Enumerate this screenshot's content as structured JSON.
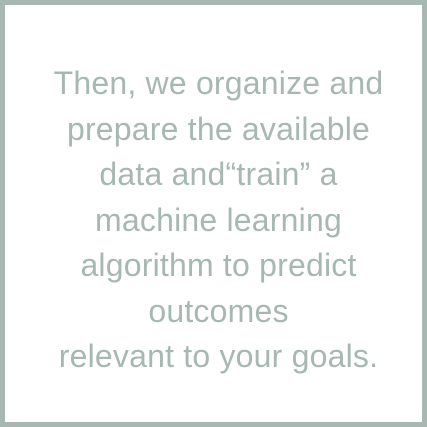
{
  "colors": {
    "border": "#a7b8b2",
    "text": "#a7b8b2",
    "background": "#ffffff"
  },
  "message": {
    "lines": [
      "Then, we organize and",
      "prepare the available",
      "data and“train” a",
      "machine learning",
      "algorithm to predict",
      "outcomes",
      "relevant to your goals."
    ]
  }
}
